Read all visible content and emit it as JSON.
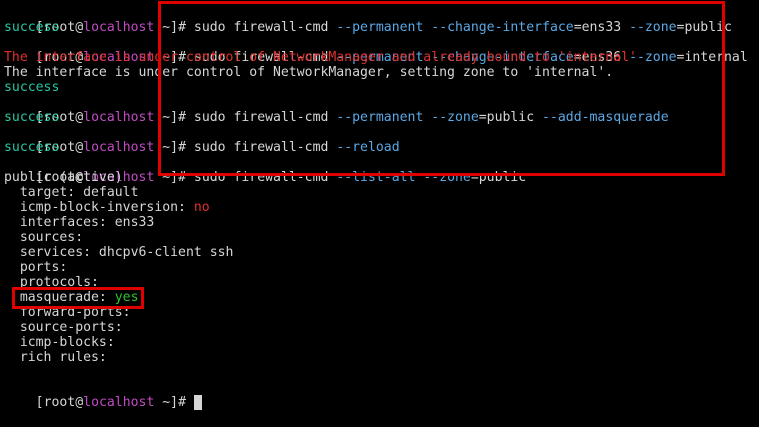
{
  "prompt": {
    "open": "[",
    "user": "root",
    "at": "@",
    "host": "localhost",
    "cwd": " ~]",
    "sign": "# "
  },
  "cmd1": {
    "base": "sudo firewall-cmd ",
    "opt1": "--permanent",
    "opt2": "--change-interface",
    "eq1": "=ens33 ",
    "opt3": "--zone",
    "eq2": "=public"
  },
  "cmd2": {
    "base": "sudo firewall-cmd ",
    "opt1": "--permanent",
    "opt2": "--change-interface",
    "eq1": "=ens36 ",
    "opt3": "--zone",
    "eq2": "=internal"
  },
  "cmd3": {
    "base": "sudo firewall-cmd ",
    "opt1": "--permanent",
    "opt2": "--zone",
    "eq1": "=public ",
    "opt3": "--add-masquerade"
  },
  "cmd4": {
    "base": "sudo firewall-cmd ",
    "opt1": "--reload"
  },
  "cmd5": {
    "base": "sudo firewall-cmd ",
    "opt1": "--list-all",
    "opt2": "--zone",
    "eq1": "=public"
  },
  "output": {
    "success": "success",
    "warning": "The interface is under control of NetworkManager and already bound to 'internal'",
    "info": "The interface is under control of NetworkManager, setting zone to 'internal'."
  },
  "zone": {
    "header": "public (active)",
    "target": "  target: default",
    "icmp_inversion_label": "  icmp-block-inversion: ",
    "icmp_inversion_value": "no",
    "interfaces": "  interfaces: ens33",
    "sources": "  sources:",
    "services": "  services: dhcpv6-client ssh",
    "ports": "  ports:",
    "protocols": "  protocols:",
    "masquerade_label": "  masquerade: ",
    "masquerade_value": "yes",
    "forward_ports": "  forward-ports:",
    "source_ports": "  source-ports:",
    "icmp_blocks": "  icmp-blocks:",
    "rich_rules": "  rich rules:"
  },
  "colors": {
    "background": "#000000",
    "text": "#d6d6d6",
    "host": "#c24bc4",
    "option": "#5aa8e6",
    "success": "#29c7a3",
    "error": "#e0312f",
    "yes": "#2fc32f",
    "highlight": "#e00000"
  }
}
